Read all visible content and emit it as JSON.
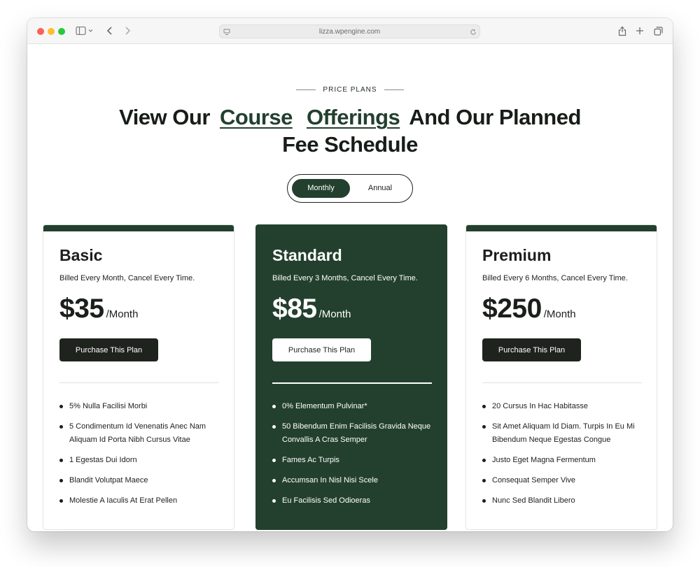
{
  "browser": {
    "url": "lizza.wpengine.com"
  },
  "section": {
    "eyebrow": "PRICE PLANS",
    "headline_pre": "View Our",
    "headline_link1": "Course",
    "headline_link2": "Offerings",
    "headline_post": "And Our Planned",
    "headline_line2": "Fee Schedule"
  },
  "billing_toggle": {
    "monthly": "Monthly",
    "annual": "Annual",
    "selected": "Monthly"
  },
  "plans": [
    {
      "name": "Basic",
      "billing": "Billed Every Month, Cancel Every Time.",
      "price": "$35",
      "period": "/Month",
      "button": "Purchase This Plan",
      "features": [
        "5% Nulla Facilisi Morbi",
        "5 Condimentum Id Venenatis Anec Nam Aliquam Id Porta Nibh Cursus Vitae",
        "1 Egestas Dui Idorn",
        "Blandit Volutpat Maece",
        "Molestie A Iaculis At Erat Pellen"
      ]
    },
    {
      "name": "Standard",
      "billing": "Billed Every 3 Months, Cancel Every Time.",
      "price": "$85",
      "period": "/Month",
      "button": "Purchase This Plan",
      "features": [
        "0% Elementum Pulvinar*",
        "50 Bibendum Enim Facilisis Gravida Neque Convallis A Cras Semper",
        "Fames Ac Turpis",
        "Accumsan In Nisl Nisi Scele",
        "Eu Facilisis Sed Odioeras"
      ]
    },
    {
      "name": "Premium",
      "billing": "Billed Every 6 Months, Cancel Every Time.",
      "price": "$250",
      "period": "/Month",
      "button": "Purchase This Plan",
      "features": [
        "20 Cursus In Hac Habitasse",
        "Sit Amet Aliquam Id Diam. Turpis In Eu Mi Bibendum Neque Egestas Congue",
        "Justo Eget Magna Fermentum",
        "Consequat Semper Vive",
        "Nunc Sed Blandit Libero"
      ]
    }
  ],
  "colors": {
    "accent_green": "#23402e",
    "dark_button": "#1f231e"
  },
  "icons": {
    "sidebar": "sidebar-icon",
    "back": "chevron-left-icon",
    "forward": "chevron-right-icon",
    "share": "share-icon",
    "new_tab": "plus-icon",
    "tabs": "tabs-overview-icon",
    "reload": "reload-icon"
  }
}
